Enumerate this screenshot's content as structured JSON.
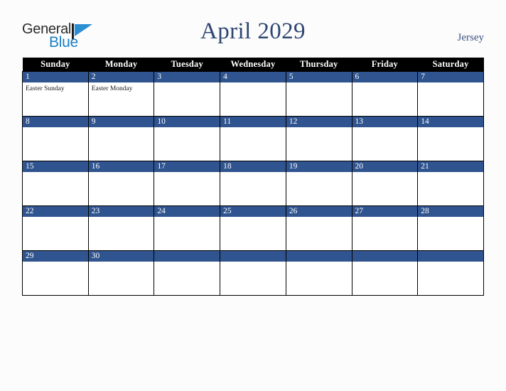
{
  "brand": {
    "name_part1": "General",
    "name_part2": "Blue",
    "color_dark": "#2b2b2b",
    "color_blue": "#1a7fc4",
    "mark_color": "#2b8fd4"
  },
  "header": {
    "title": "April 2029",
    "region": "Jersey",
    "title_color": "#2e4670",
    "region_color": "#3d5480"
  },
  "calendar": {
    "header_bg": "#000000",
    "header_fg": "#ffffff",
    "daynum_band_color": "#2f548f",
    "grid_border_color": "#000000",
    "cell_bg": "#ffffff",
    "weekdays": [
      "Sunday",
      "Monday",
      "Tuesday",
      "Wednesday",
      "Thursday",
      "Friday",
      "Saturday"
    ],
    "weeks": [
      [
        {
          "day": "1",
          "events": [
            "Easter Sunday"
          ]
        },
        {
          "day": "2",
          "events": [
            "Easter Monday"
          ]
        },
        {
          "day": "3",
          "events": []
        },
        {
          "day": "4",
          "events": []
        },
        {
          "day": "5",
          "events": []
        },
        {
          "day": "6",
          "events": []
        },
        {
          "day": "7",
          "events": []
        }
      ],
      [
        {
          "day": "8",
          "events": []
        },
        {
          "day": "9",
          "events": []
        },
        {
          "day": "10",
          "events": []
        },
        {
          "day": "11",
          "events": []
        },
        {
          "day": "12",
          "events": []
        },
        {
          "day": "13",
          "events": []
        },
        {
          "day": "14",
          "events": []
        }
      ],
      [
        {
          "day": "15",
          "events": []
        },
        {
          "day": "16",
          "events": []
        },
        {
          "day": "17",
          "events": []
        },
        {
          "day": "18",
          "events": []
        },
        {
          "day": "19",
          "events": []
        },
        {
          "day": "20",
          "events": []
        },
        {
          "day": "21",
          "events": []
        }
      ],
      [
        {
          "day": "22",
          "events": []
        },
        {
          "day": "23",
          "events": []
        },
        {
          "day": "24",
          "events": []
        },
        {
          "day": "25",
          "events": []
        },
        {
          "day": "26",
          "events": []
        },
        {
          "day": "27",
          "events": []
        },
        {
          "day": "28",
          "events": []
        }
      ],
      [
        {
          "day": "29",
          "events": []
        },
        {
          "day": "30",
          "events": []
        },
        {
          "day": "",
          "events": []
        },
        {
          "day": "",
          "events": []
        },
        {
          "day": "",
          "events": []
        },
        {
          "day": "",
          "events": []
        },
        {
          "day": "",
          "events": []
        }
      ]
    ]
  }
}
